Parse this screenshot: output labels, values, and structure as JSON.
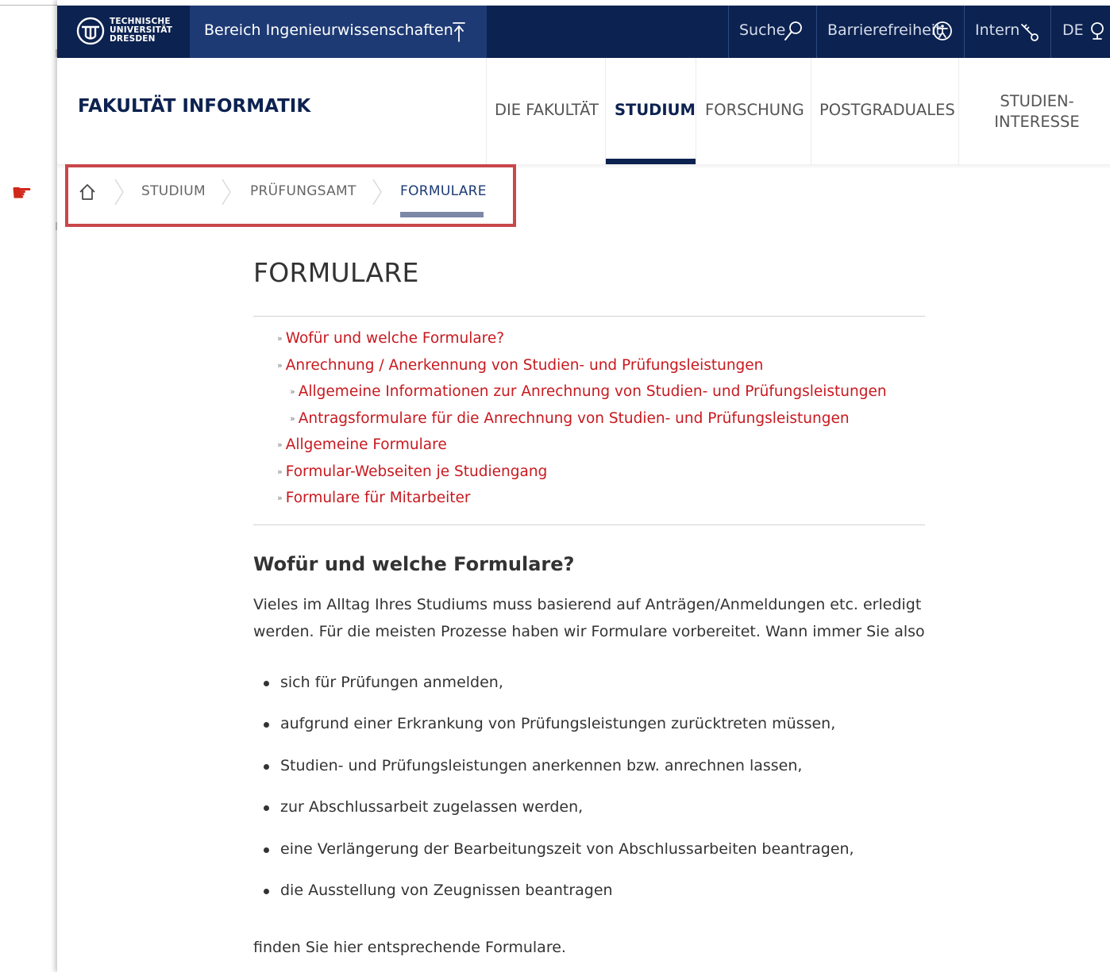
{
  "gutter": {
    "pointer_icon": "pointing-hand-icon",
    "pointer_glyph": "☛"
  },
  "topbar": {
    "logo_line1": "TECHNISCHE",
    "logo_line2": "UNIVERSITÄT",
    "logo_line3": "DRESDEN",
    "bereich_label": "Bereich Ingenieurwissenschaften",
    "search_label": "Suche",
    "accessibility_label": "Barrierefreiheit",
    "intern_label": "Intern",
    "language_label": "DE",
    "colors": {
      "background": "#0c2250",
      "bereich_background": "#1d3a74"
    }
  },
  "header": {
    "site_title": "FAKULTÄT INFORMATIK",
    "nav": [
      {
        "label": "DIE FAKULTÄT",
        "active": false
      },
      {
        "label": "STUDIUM",
        "active": true
      },
      {
        "label": "FORSCHUNG",
        "active": false
      },
      {
        "label": "POSTGRADUALES",
        "active": false
      }
    ],
    "nav_two_line": {
      "line1": "STUDIEN-",
      "line2": "INTERESSE"
    }
  },
  "breadcrumb": {
    "home_icon": "home-icon",
    "items": [
      "STUDIUM",
      "PRÜFUNGSAMT",
      "FORMULARE"
    ],
    "highlight_color": "#c9474a"
  },
  "main": {
    "title": "FORMULARE",
    "toc_arrow": "»",
    "toc": [
      {
        "label": "Wofür und welche Formulare?",
        "level": 1
      },
      {
        "label": "Anrechnung / Anerkennung von Studien- und Prüfungsleistungen",
        "level": 1
      },
      {
        "label": "Allgemeine Informationen zur Anrechnung von Studien- und Prüfungsleistungen",
        "level": 2
      },
      {
        "label": "Antragsformulare für die Anrechnung von Studien- und Prüfungsleistungen",
        "level": 2
      },
      {
        "label": "Allgemeine Formulare",
        "level": 1
      },
      {
        "label": "Formular-Webseiten je Studiengang",
        "level": 1
      },
      {
        "label": "Formulare für Mitarbeiter",
        "level": 1
      }
    ],
    "link_color": "#c8191f",
    "section_title": "Wofür und welche Formulare?",
    "intro_line1": "Vieles im Alltag Ihres Studiums muss basierend auf Anträgen/Anmeldungen etc. erledigt",
    "intro_line2": "werden. Für die meisten Prozesse haben wir Formulare vorbereitet. Wann immer Sie also",
    "bullets": [
      "sich für Prüfungen anmelden,",
      "aufgrund einer Erkrankung von Prüfungsleistungen zurücktreten müssen,",
      "Studien- und Prüfungsleistungen anerkennen bzw. anrechnen lassen,",
      "zur Abschlussarbeit zugelassen  werden,",
      "eine Verlängerung der Bearbeitungszeit von Abschlussarbeiten beantragen,",
      "die Ausstellung von Zeugnissen beantragen"
    ],
    "outro": "finden Sie hier entsprechende Formulare."
  }
}
